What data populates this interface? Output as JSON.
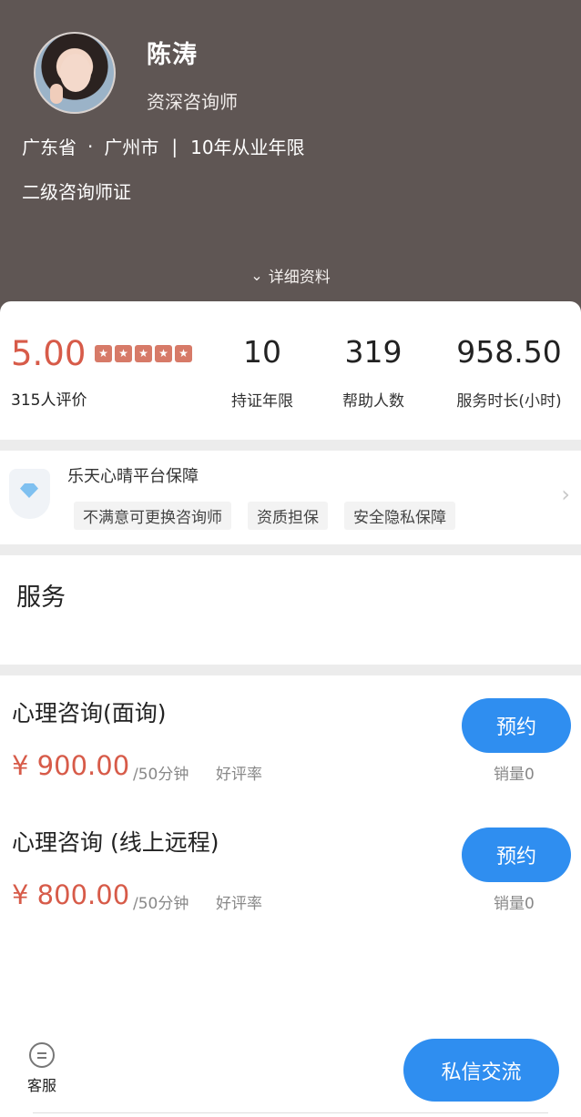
{
  "profile": {
    "name": "陈涛",
    "title": "资深咨询师",
    "province": "广东省",
    "dot": "·",
    "city": "广州市",
    "separator": "|",
    "experience": "10年从业年限",
    "certificate": "二级咨询师证",
    "details_label": "详细资料",
    "avatar_icon": "avatar-photo"
  },
  "stats": {
    "rating": "5.00",
    "stars": 5,
    "reviews": "315人评价",
    "items": [
      {
        "value": "10",
        "label": "持证年限"
      },
      {
        "value": "319",
        "label": "帮助人数"
      },
      {
        "value": "958.50",
        "label": "服务时长(小时)"
      }
    ]
  },
  "guarantee": {
    "title": "乐天心晴平台保障",
    "tags": [
      "不满意可更换咨询师",
      "资质担保",
      "安全隐私保障"
    ]
  },
  "services": {
    "heading": "服务",
    "items": [
      {
        "name": "心理咨询(面询)",
        "price": "¥ 900.00",
        "unit": "/50分钟",
        "rate": "好评率",
        "button": "预约",
        "sales": "销量0"
      },
      {
        "name": "心理咨询 (线上远程)",
        "price": "¥ 800.00",
        "unit": "/50分钟",
        "rate": "好评率",
        "button": "预约",
        "sales": "销量0"
      }
    ]
  },
  "bottom": {
    "service_label": "客服",
    "chat_button": "私信交流"
  },
  "colors": {
    "header_bg": "#5f5654",
    "accent_red": "#d75b49",
    "primary_blue": "#2f8ef0"
  }
}
